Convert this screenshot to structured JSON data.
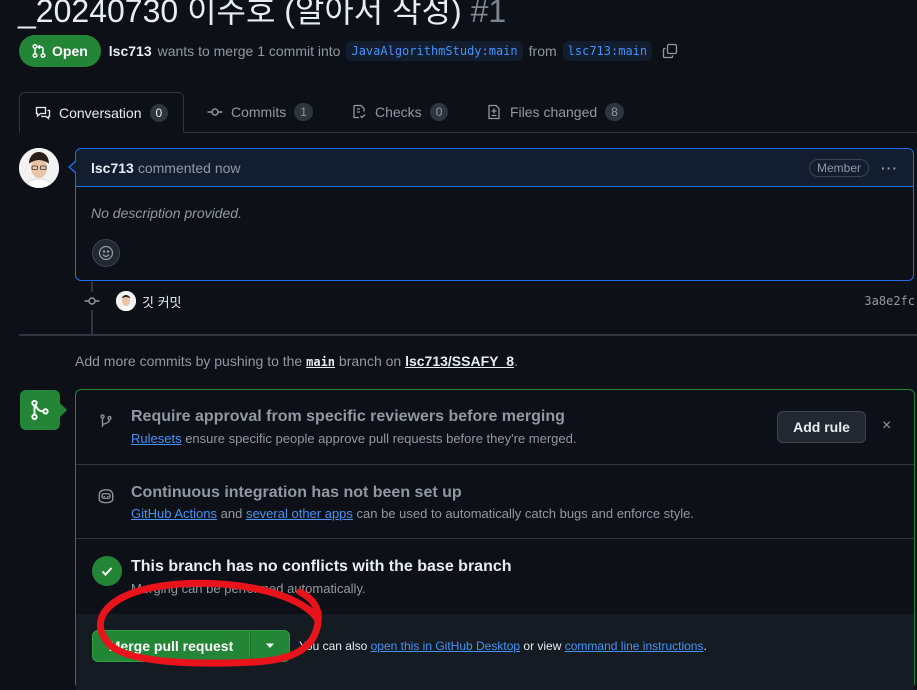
{
  "pr": {
    "title": "_20240730 이주호 (알아서 작성)",
    "number": "#1",
    "state": "Open",
    "author": "lsc713",
    "merge_text_1": "wants to merge 1 commit into",
    "base_branch": "JavaAlgorithmStudy:main",
    "merge_text_2": "from",
    "head_branch": "lsc713:main"
  },
  "tabs": [
    {
      "label": "Conversation",
      "count": "0",
      "icon": "comment-discussion-icon"
    },
    {
      "label": "Commits",
      "count": "1",
      "icon": "git-commit-icon"
    },
    {
      "label": "Checks",
      "count": "0",
      "icon": "checklist-icon"
    },
    {
      "label": "Files changed",
      "count": "8",
      "icon": "file-diff-icon"
    }
  ],
  "comment": {
    "author": "lsc713",
    "time": "commented now",
    "role": "Member",
    "body": "No description provided."
  },
  "commit": {
    "message": "깃 커밋",
    "sha": "3a8e2fc"
  },
  "push_hint": {
    "prefix": "Add more commits by pushing to the",
    "branch": "main",
    "middle": "branch on",
    "repo": "lsc713/SSAFY_8",
    "suffix": "."
  },
  "merge_box": {
    "rulesets": {
      "title": "Require approval from specific reviewers before merging",
      "link": "Rulesets",
      "text": "ensure specific people approve pull requests before they're merged.",
      "button": "Add rule",
      "dismiss": "×"
    },
    "ci": {
      "title": "Continuous integration has not been set up",
      "link1": "GitHub Actions",
      "and": "and",
      "link2": "several other apps",
      "text": "can be used to automatically catch bugs and enforce style."
    },
    "conflicts": {
      "title": "This branch has no conflicts with the base branch",
      "text": "Merging can be performed automatically."
    },
    "footer": {
      "merge_button": "Merge pull request",
      "alt_prefix": "You can also",
      "alt_link1": "open this in GitHub Desktop",
      "alt_middle": "or view",
      "alt_link2": "command line instructions",
      "alt_suffix": "."
    }
  },
  "colors": {
    "accent_green": "#238636",
    "link_blue": "#4493f8",
    "annotation_red": "#e8131b"
  }
}
